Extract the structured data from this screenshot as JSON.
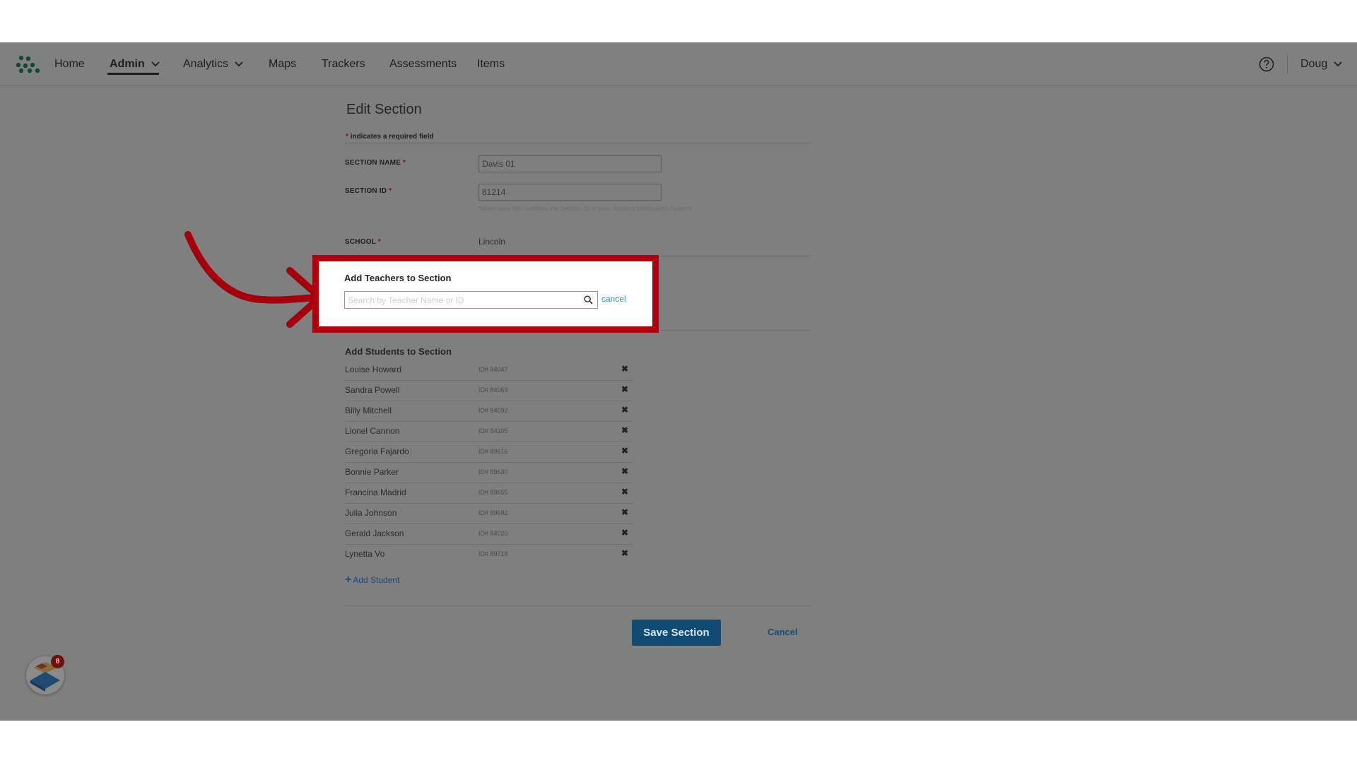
{
  "nav": {
    "items": [
      {
        "label": "Home"
      },
      {
        "label": "Admin"
      },
      {
        "label": "Analytics"
      },
      {
        "label": "Maps"
      },
      {
        "label": "Trackers"
      },
      {
        "label": "Assessments"
      },
      {
        "label": "Items"
      }
    ],
    "user": "Doug"
  },
  "form": {
    "title": "Edit Section",
    "required_note": "indicates a required field",
    "required_mark": "*",
    "section_name_label": "SECTION NAME",
    "section_name_value": "Davis 01",
    "section_id_label": "SECTION ID",
    "section_id_value": "81214",
    "section_id_hint": "*Make sure this matches the Section ID in your Student Information System",
    "school_label": "SCHOOL",
    "school_value": "Lincoln"
  },
  "teachers": {
    "title": "Add Teachers to Section",
    "search_placeholder": "Search by Teacher Name or ID",
    "cancel_label": "cancel"
  },
  "students": {
    "title": "Add Students to Section",
    "rows": [
      {
        "name": "Louise Howard",
        "id": "ID# 84047"
      },
      {
        "name": "Sandra Powell",
        "id": "ID# 84069"
      },
      {
        "name": "Billy Mitchell",
        "id": "ID# 84092"
      },
      {
        "name": "Lionel Cannon",
        "id": "ID# 84105"
      },
      {
        "name": "Gregoria Fajardo",
        "id": "ID# 89616"
      },
      {
        "name": "Bonnie Parker",
        "id": "ID# 89630"
      },
      {
        "name": "Francina Madrid",
        "id": "ID# 89655"
      },
      {
        "name": "Julia Johnson",
        "id": "ID# 89692"
      },
      {
        "name": "Gerald Jackson",
        "id": "ID# 84020"
      },
      {
        "name": "Lynetta Vo",
        "id": "ID# 89718"
      }
    ],
    "remove_glyph": "✖",
    "add_label": "Add Student"
  },
  "actions": {
    "save_label": "Save Section",
    "cancel_label": "Cancel"
  },
  "widget": {
    "badge_count": "8"
  },
  "colors": {
    "highlight": "#b0000f",
    "overlay": "#7f7f7f",
    "primary": "#104b73",
    "link": "#2b8fd4"
  }
}
